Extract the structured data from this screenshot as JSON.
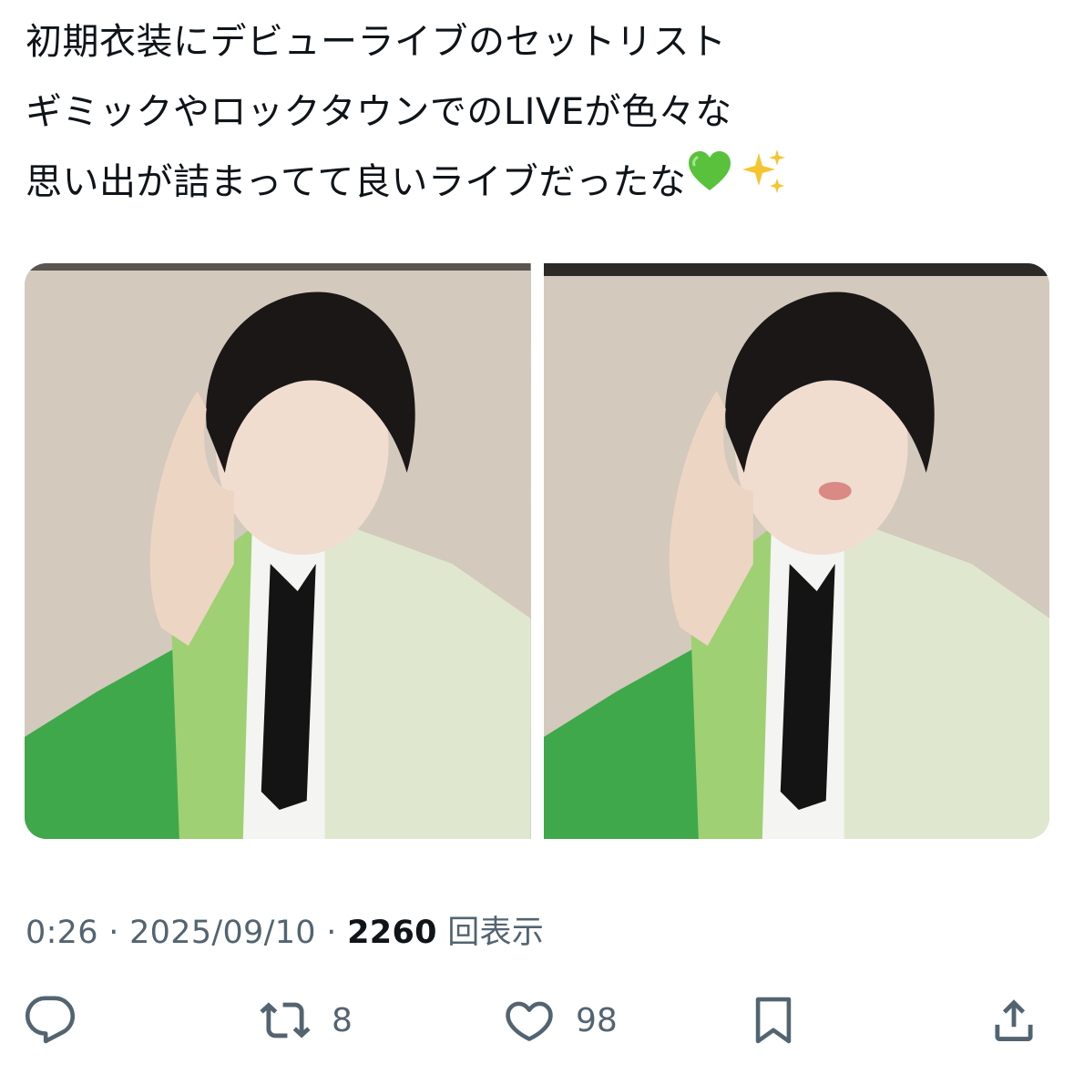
{
  "tweet": {
    "lines": [
      "初期衣装にデビューライブのセットリスト",
      "ギミックやロックタウンでのLIVEが色々な",
      "思い出が詰まってて良いライブだったな"
    ],
    "emojis": [
      "green-heart",
      "sparkles"
    ]
  },
  "media": [
    {
      "alt": "photo-1"
    },
    {
      "alt": "photo-2"
    }
  ],
  "meta": {
    "time": "0:26",
    "separator": "·",
    "date": "2025/09/10",
    "views": "2260",
    "views_label": "回表示"
  },
  "actions": {
    "reply": {
      "icon": "reply-icon",
      "count": ""
    },
    "retweet": {
      "icon": "retweet-icon",
      "count": "8"
    },
    "like": {
      "icon": "heart-icon",
      "count": "98"
    },
    "bookmark": {
      "icon": "bookmark-icon",
      "count": ""
    },
    "share": {
      "icon": "share-icon",
      "count": ""
    }
  },
  "colors": {
    "text": "#0f1419",
    "secondary": "#536471",
    "emoji_heart": "#59c13b",
    "emoji_sparkle": "#f5c531",
    "costume_green": "#3fa84a",
    "costume_pale": "#dfe8cf"
  }
}
